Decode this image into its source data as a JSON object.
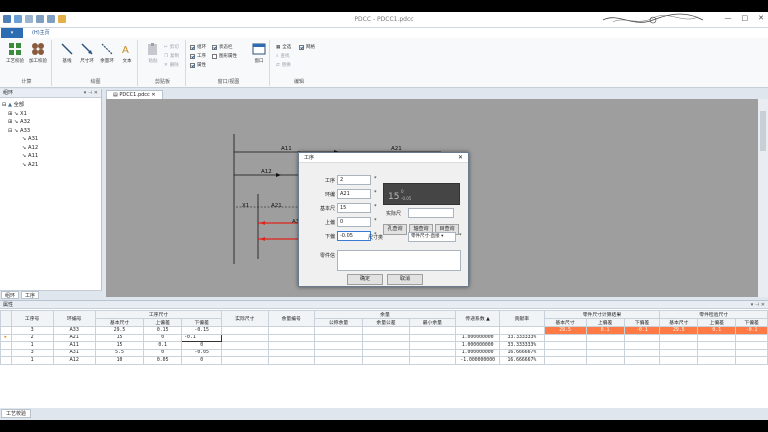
{
  "window": {
    "title": "PDCC - PDCC1.pdcc"
  },
  "menu": {
    "file_label": "",
    "tab_label": "(H)主页"
  },
  "ribbon": {
    "groups": [
      {
        "label": "计算",
        "buttons": [
          "工艺校验",
          "加工校验"
        ]
      },
      {
        "label": "绘图",
        "buttons": [
          "基线",
          "尺寸环",
          "余量环",
          "文本"
        ]
      },
      {
        "label": "剪贴板",
        "buttons": [
          "粘贴"
        ],
        "small": [
          "剪切",
          "复制",
          "删除"
        ]
      },
      {
        "label": "窗口/视图",
        "checks": [
          {
            "label": "组环",
            "checked": true
          },
          {
            "label": "状态栏",
            "checked": true
          },
          {
            "label": "工序",
            "checked": true
          },
          {
            "label": "图形属性",
            "checked": false
          },
          {
            "label": "属性",
            "checked": true
          }
        ],
        "window_btn": "窗口"
      },
      {
        "label": "编辑",
        "small": [
          "全选",
          "查找",
          "替换"
        ],
        "extra": "网格"
      }
    ]
  },
  "leftpanel": {
    "title": "组环",
    "tree": [
      {
        "label": "全部",
        "level": 0
      },
      {
        "label": "X1",
        "level": 1
      },
      {
        "label": "A32",
        "level": 1
      },
      {
        "label": "A33",
        "level": 1
      },
      {
        "label": "A31",
        "level": 2
      },
      {
        "label": "A12",
        "level": 2
      },
      {
        "label": "A11",
        "level": 2
      },
      {
        "label": "A21",
        "level": 2
      }
    ],
    "tabs": [
      "组环",
      "工序"
    ]
  },
  "document": {
    "tab": "PDCC1.pdcc",
    "labels": {
      "a11": "A11",
      "a21": "A21",
      "a12": "A12",
      "x1": "X1",
      "a21b": "A21",
      "a3": "A3"
    }
  },
  "dialog": {
    "title": "工序",
    "fields": {
      "process_label": "工序",
      "process_value": "2",
      "ring_label": "环编",
      "ring_value": "A21",
      "basic_label": "基本尺",
      "basic_value": "15",
      "upper_label": "上偏",
      "upper_value": "0",
      "lower_label": "下偏",
      "lower_value": "-0.05",
      "actual_label": "实际尺",
      "size_type_label": "尺寸类",
      "size_type_value": "零件尺寸-直接",
      "part_label": "零件信"
    },
    "buttons": {
      "hole": "孔查询",
      "shaft": "轴查询",
      "other": "目查询",
      "ok": "确定",
      "cancel": "取消"
    }
  },
  "properties": {
    "title": "属性",
    "headers": {
      "process": "工序号",
      "ring": "环编号",
      "process_dim": "工序尺寸",
      "basic": "基本尺寸",
      "upper": "上偏差",
      "lower": "下偏差",
      "actual": "实际尺寸",
      "allowance_no": "余量编号",
      "allowance": "余量",
      "nominal": "公称余量",
      "allowance_tol": "余量公差",
      "min_allowance": "最小余量",
      "coef": "传递系数",
      "contrib": "贡献率",
      "calc": "零件尺寸计算结果",
      "check": "零件检验尺寸",
      "c_basic": "基本尺寸",
      "c_upper": "上偏差",
      "c_lower": "下偏差",
      "k_basic": "基本尺寸",
      "k_upper": "上偏差",
      "k_lower": "下偏差"
    },
    "rows": [
      {
        "process": "3",
        "ring": "A33",
        "basic": "29.5",
        "upper": "0.15",
        "lower": "-0.15",
        "coef": "",
        "contrib": "",
        "c_basic": "29.5",
        "c_upper": "0.1",
        "c_lower": "-0.1",
        "k_basic": "29.5",
        "k_upper": "0.1",
        "k_lower": "-0.1"
      },
      {
        "process": "2",
        "ring": "A21",
        "basic": "15",
        "upper": "0",
        "lower": "-0.1",
        "coef": "1.000000000",
        "contrib": "33.333333%",
        "c_basic": "",
        "c_upper": "",
        "c_lower": "",
        "k_basic": "",
        "k_upper": "",
        "k_lower": ""
      },
      {
        "process": "1",
        "ring": "A11",
        "basic": "15",
        "upper": "0.1",
        "lower": "0",
        "coef": "1.000000000",
        "contrib": "33.333333%",
        "c_basic": "",
        "c_upper": "",
        "c_lower": "",
        "k_basic": "",
        "k_upper": "",
        "k_lower": ""
      },
      {
        "process": "3",
        "ring": "A31",
        "basic": "5.5",
        "upper": "0",
        "lower": "-0.05",
        "coef": "1.000000000",
        "contrib": "16.666667%",
        "c_basic": "",
        "c_upper": "",
        "c_lower": "",
        "k_basic": "",
        "k_upper": "",
        "k_lower": ""
      },
      {
        "process": "1",
        "ring": "A12",
        "basic": "10",
        "upper": "0.05",
        "lower": "0",
        "coef": "-1.000000000",
        "contrib": "16.666667%",
        "c_basic": "",
        "c_upper": "",
        "c_lower": "",
        "k_basic": "",
        "k_upper": "",
        "k_lower": ""
      }
    ]
  },
  "bottom": {
    "tab": "工艺校验"
  },
  "colors": {
    "accent": "#2b6cb3",
    "highlight": "#ff7a45",
    "canvas": "#9e9e9e",
    "dim_line": "#e0241b"
  }
}
